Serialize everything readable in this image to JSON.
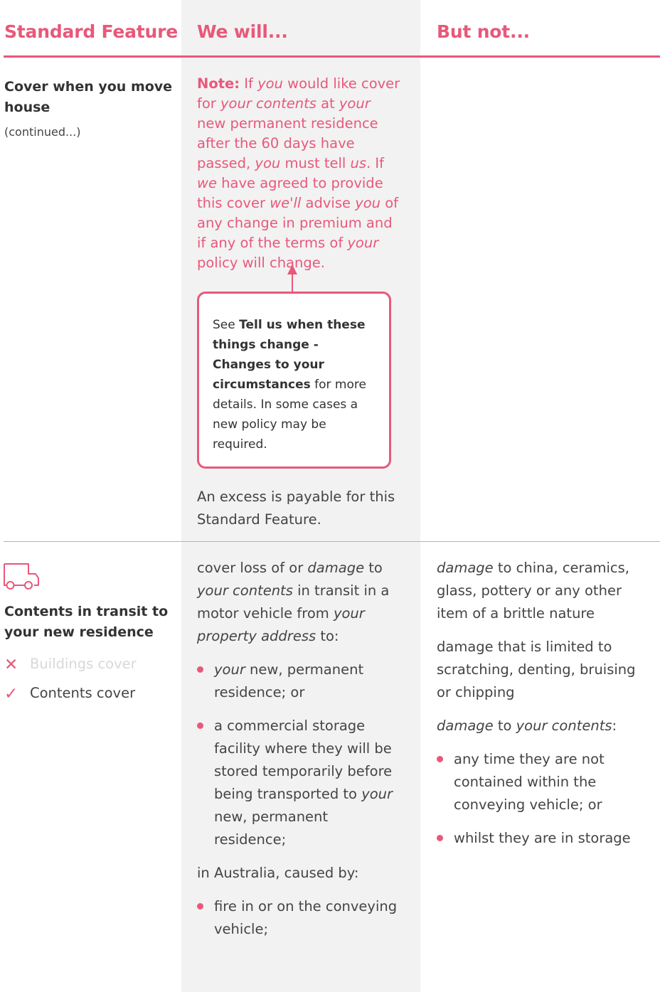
{
  "header": {
    "col1": "Standard Feature",
    "col2": "We will...",
    "col3": "But not..."
  },
  "colors": {
    "accent": "#e8587a",
    "column_bg": "#f2f2f2",
    "text": "#444444",
    "disabled": "#d8d8d8"
  },
  "row1": {
    "title": "Cover when you move house",
    "continued": "(continued...)",
    "note": {
      "label": "Note:",
      "t1": " If ",
      "i1": "you",
      "t2": " would like cover for ",
      "i2": "your contents",
      "t3": " at ",
      "i3": "your",
      "t4": " new permanent residence after the 60 days have passed, ",
      "i4": "you",
      "t5": " must tell ",
      "i5": "us",
      "t6": ". If ",
      "i6": "we",
      "t7": " have agreed to provide this cover ",
      "i7": "we'll",
      "t8": " advise ",
      "i8": "you",
      "t9": " of any change in premium and if any of the terms of ",
      "i9": "your",
      "t10": " policy will change."
    },
    "callout": {
      "see": "See ",
      "bold": "Tell us when these things change - Changes to your circumstances",
      "rest": " for more details. In some cases a new policy may be required."
    },
    "excess": "An excess is payable for this Standard Feature."
  },
  "row2": {
    "icon": "truck-icon",
    "title": "Contents in transit to your new residence",
    "covers": [
      {
        "label": "Buildings cover",
        "included": false,
        "mark": "✕"
      },
      {
        "label": "Contents cover",
        "included": true,
        "mark": "✓"
      }
    ],
    "we_will": {
      "intro": {
        "t1": "cover loss of or ",
        "i1": "damage",
        "t2": " to ",
        "i2": "your contents",
        "t3": " in transit in a motor vehicle from ",
        "i3": "your property address",
        "t4": " to:"
      },
      "b1": {
        "i1": "your",
        "t1": " new, permanent residence; or"
      },
      "b2": {
        "t1": "a commercial storage facility where they will be stored temporarily before being transported to ",
        "i1": "your",
        "t2": " new, permanent residence;"
      },
      "mid": "in Australia, caused by:",
      "b3": {
        "t1": "fire in or on the conveying vehicle;"
      }
    },
    "but_not": {
      "p1": {
        "i1": "damage",
        "t1": " to china, ceramics, glass, pottery or any other item of a brittle nature"
      },
      "p2": "damage that is limited to scratching, denting, bruising or chipping",
      "p3": {
        "i1": "damage",
        "t1": " to ",
        "i2": "your contents",
        "t2": ":"
      },
      "b1": "any time they are not contained within the conveying vehicle; or",
      "b2": "whilst they are in storage"
    }
  }
}
